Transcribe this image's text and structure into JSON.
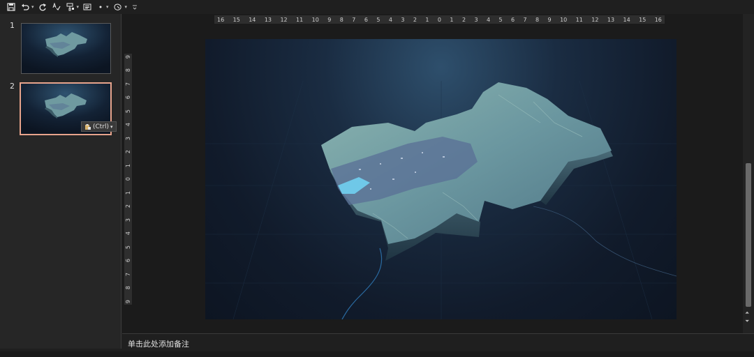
{
  "quick_access": {
    "icons": [
      "save-icon",
      "undo-icon",
      "redo-icon",
      "spellcheck-icon",
      "format-painter-icon",
      "shape-icon",
      "customize-icon"
    ]
  },
  "thumbnails": [
    {
      "number": "1",
      "selected": false
    },
    {
      "number": "2",
      "selected": true
    }
  ],
  "paste_options": {
    "label": "(Ctrl)"
  },
  "horizontal_ruler": [
    "16",
    "15",
    "14",
    "13",
    "12",
    "11",
    "10",
    "9",
    "8",
    "7",
    "6",
    "5",
    "4",
    "3",
    "2",
    "1",
    "0",
    "1",
    "2",
    "3",
    "4",
    "5",
    "6",
    "7",
    "8",
    "9",
    "10",
    "11",
    "12",
    "13",
    "14",
    "15",
    "16"
  ],
  "vertical_ruler": [
    "9",
    "8",
    "7",
    "6",
    "5",
    "4",
    "3",
    "2",
    "1",
    "0",
    "1",
    "2",
    "3",
    "4",
    "5",
    "6",
    "7",
    "8",
    "9"
  ],
  "notes": {
    "placeholder": "单击此处添加备注"
  },
  "colors": {
    "accent_selection": "#e8a48c",
    "slide_bg": "#111b2b",
    "terrain": "#6f9aa0"
  }
}
